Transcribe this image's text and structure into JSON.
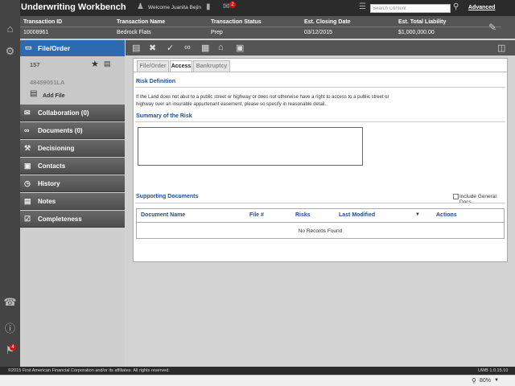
{
  "app": {
    "title": "Underwriting Workbench",
    "welcome": "Welcome Juanita Bejin",
    "mail_count": "2",
    "search_placeholder": "Search Content",
    "advanced_label": "Advanced"
  },
  "transaction": {
    "columns": [
      {
        "label": "Transaction ID",
        "value": "10008961"
      },
      {
        "label": "Transaction Name",
        "value": "Bedrock Flats"
      },
      {
        "label": "Transaction Status",
        "value": "Prep"
      },
      {
        "label": "Est. Closing Date",
        "value": "03/12/2015"
      },
      {
        "label": "Est. Total Liability",
        "value": "$1,000,000.00"
      }
    ]
  },
  "sidebar": {
    "active_item": "File/Order",
    "file_number": "157",
    "file_code": "48459051LA",
    "add_file_label": "Add File",
    "items": [
      {
        "label": "Collaboration (0)",
        "icon": "chat-icon"
      },
      {
        "label": "Documents (0)",
        "icon": "paperclip-icon"
      },
      {
        "label": "Decisioning",
        "icon": "gavel-icon"
      },
      {
        "label": "Contacts",
        "icon": "contacts-icon"
      },
      {
        "label": "History",
        "icon": "clock-icon"
      },
      {
        "label": "Notes",
        "icon": "notes-icon"
      },
      {
        "label": "Completeness",
        "icon": "checklist-icon"
      }
    ]
  },
  "rail": {
    "notification_count": "4"
  },
  "content": {
    "tabs": [
      "File/Order",
      "Access",
      "Bankruptcy"
    ],
    "active_tab": "Access",
    "risk_definition_title": "Risk Definition",
    "risk_definition_text": "If the Land does not abut to a public street or highway or does not otherwise have a right to access to a public street or highway over an insurable appurtenant easement, please so specify in reasonable detail.",
    "summary_title": "Summary of the Risk",
    "supporting_title": "Supporting Documents",
    "include_general_label": "Include General Docs",
    "table": {
      "headers": [
        "Document Name",
        "File #",
        "Risks",
        "Last Modified",
        "Actions"
      ],
      "empty_text": "No Records Found"
    }
  },
  "footer": {
    "copyright": "©2015 First American Financial Corporation and/or its affiliates. All rights reserved.",
    "version": "UWB 1.0.15.10"
  },
  "statusbar": {
    "zoom": "80%"
  }
}
